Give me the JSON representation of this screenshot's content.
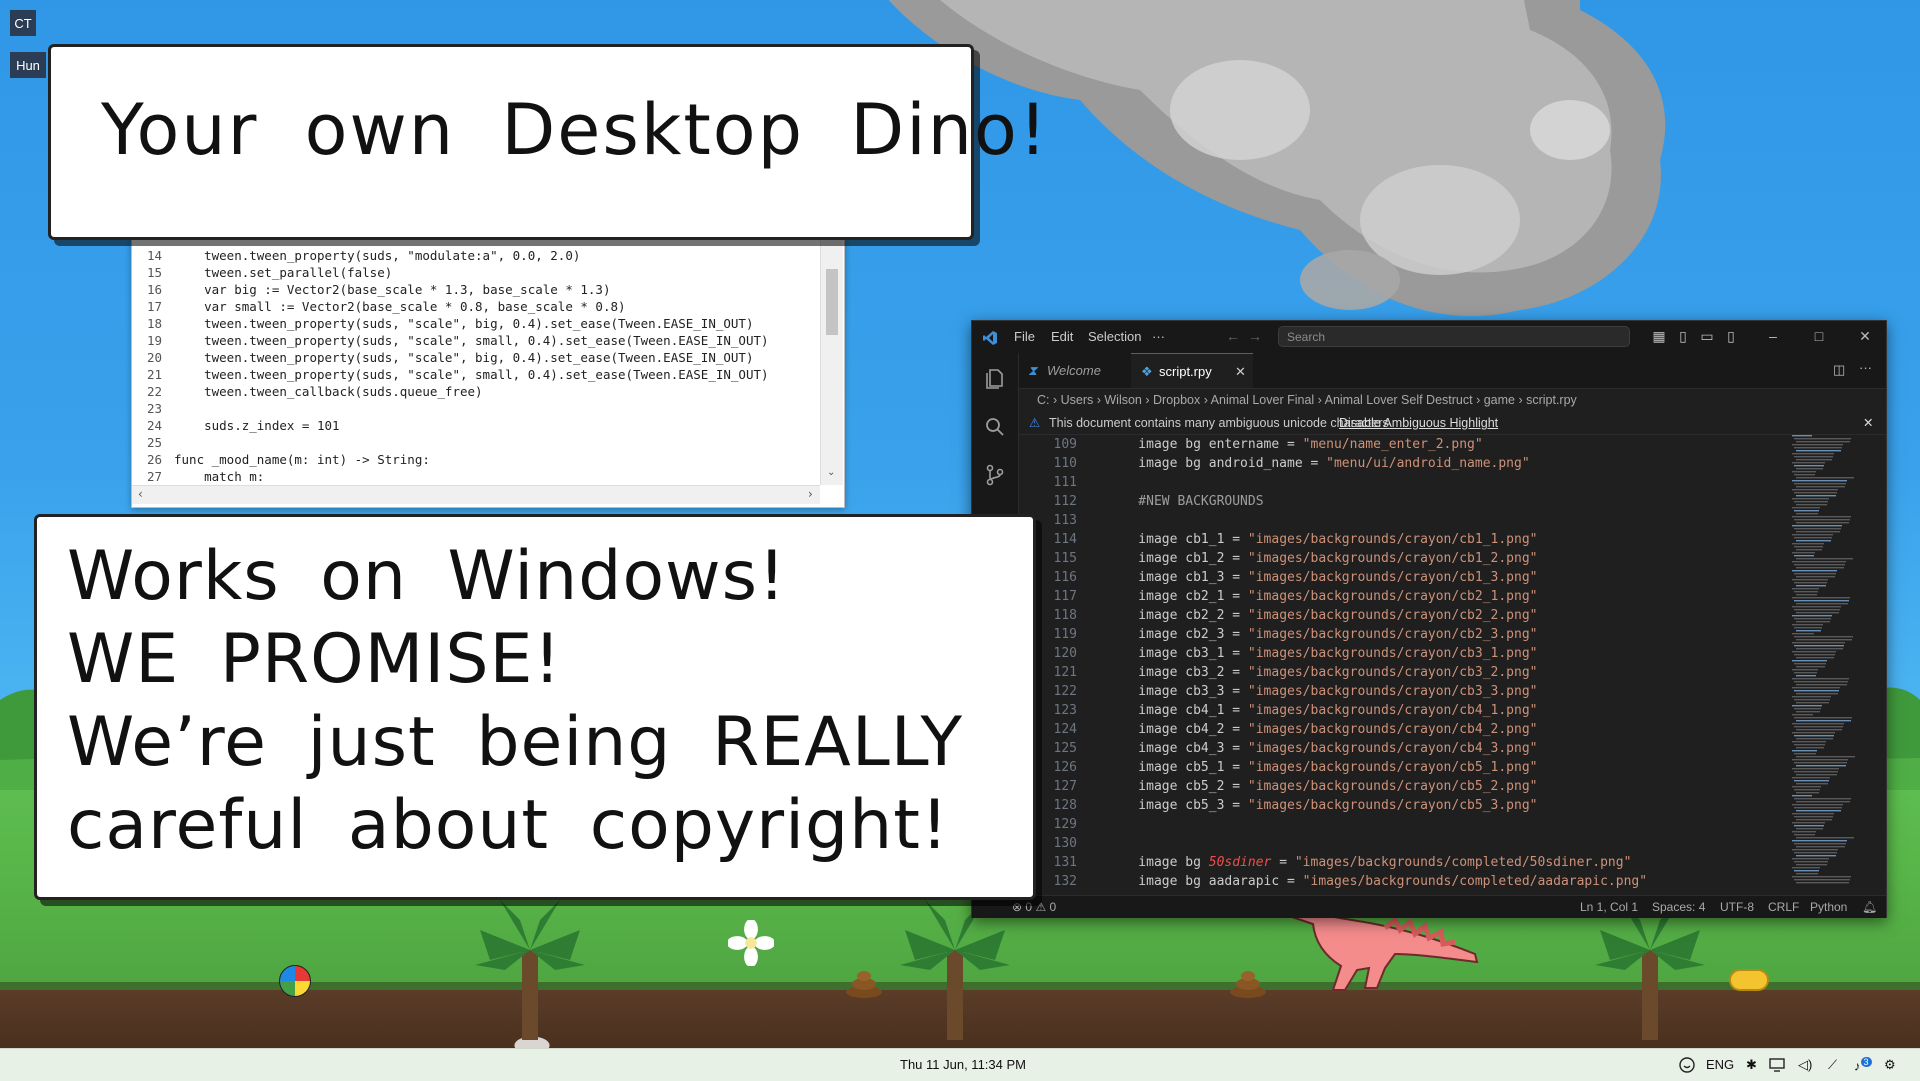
{
  "desktop": {
    "icons": [
      {
        "label": "CT"
      },
      {
        "label": "Hun"
      }
    ]
  },
  "captions": {
    "top": "Your own Desktop Dino!",
    "bottom": [
      "Works on Windows!",
      "WE PROMISE!",
      "We’re just being REALLY",
      "careful about copyright!"
    ]
  },
  "gd_editor": {
    "lines": [
      {
        "num": "14",
        "text": "    tween.tween_property(suds, \"modulate:a\", 0.0, 2.0)"
      },
      {
        "num": "15",
        "text": "    tween.set_parallel(false)"
      },
      {
        "num": "16",
        "text": "    var big := Vector2(base_scale * 1.3, base_scale * 1.3)"
      },
      {
        "num": "17",
        "text": "    var small := Vector2(base_scale * 0.8, base_scale * 0.8)"
      },
      {
        "num": "18",
        "text": "    tween.tween_property(suds, \"scale\", big, 0.4).set_ease(Tween.EASE_IN_OUT)"
      },
      {
        "num": "19",
        "text": "    tween.tween_property(suds, \"scale\", small, 0.4).set_ease(Tween.EASE_IN_OUT)"
      },
      {
        "num": "20",
        "text": "    tween.tween_property(suds, \"scale\", big, 0.4).set_ease(Tween.EASE_IN_OUT)"
      },
      {
        "num": "21",
        "text": "    tween.tween_property(suds, \"scale\", small, 0.4).set_ease(Tween.EASE_IN_OUT)"
      },
      {
        "num": "22",
        "text": "    tween.tween_callback(suds.queue_free)"
      },
      {
        "num": "23",
        "text": ""
      },
      {
        "num": "24",
        "text": "    suds.z_index = 101"
      },
      {
        "num": "25",
        "text": ""
      },
      {
        "num": "26",
        "text": "func _mood_name(m: int) -> String:"
      },
      {
        "num": "27",
        "text": "    match m:"
      }
    ]
  },
  "vscode": {
    "menu": [
      "File",
      "Edit",
      "Selection",
      "···"
    ],
    "search_placeholder": "Search",
    "tabs": [
      {
        "label": "Welcome"
      },
      {
        "label": "script.rpy"
      }
    ],
    "breadcrumb": [
      "C:",
      "Users",
      "Wilson",
      "Dropbox",
      "Animal Lover Final",
      "Animal Lover Self Destruct",
      "game",
      "script.rpy"
    ],
    "warning": {
      "message": "This document contains many ambiguous unicode characters",
      "action": "Disable Ambiguous Highlight"
    },
    "lines": [
      {
        "num": "109",
        "pre": "    image bg entername = ",
        "str": "\"menu/name_enter_2.png\""
      },
      {
        "num": "110",
        "pre": "    image bg android_name = ",
        "str": "\"menu/ui/android_name.png\""
      },
      {
        "num": "111",
        "pre": "",
        "str": ""
      },
      {
        "num": "112",
        "pre": "",
        "str": "",
        "cmt": "    #NEW BACKGROUNDS"
      },
      {
        "num": "113",
        "pre": "",
        "str": ""
      },
      {
        "num": "114",
        "pre": "    image cb1_1 = ",
        "str": "\"images/backgrounds/crayon/cb1_1.png\""
      },
      {
        "num": "115",
        "pre": "    image cb1_2 = ",
        "str": "\"images/backgrounds/crayon/cb1_2.png\""
      },
      {
        "num": "116",
        "pre": "    image cb1_3 = ",
        "str": "\"images/backgrounds/crayon/cb1_3.png\""
      },
      {
        "num": "117",
        "pre": "    image cb2_1 = ",
        "str": "\"images/backgrounds/crayon/cb2_1.png\""
      },
      {
        "num": "118",
        "pre": "    image cb2_2 = ",
        "str": "\"images/backgrounds/crayon/cb2_2.png\""
      },
      {
        "num": "119",
        "pre": "    image cb2_3 = ",
        "str": "\"images/backgrounds/crayon/cb2_3.png\""
      },
      {
        "num": "120",
        "pre": "    image cb3_1 = ",
        "str": "\"images/backgrounds/crayon/cb3_1.png\""
      },
      {
        "num": "121",
        "pre": "    image cb3_2 = ",
        "str": "\"images/backgrounds/crayon/cb3_2.png\""
      },
      {
        "num": "122",
        "pre": "    image cb3_3 = ",
        "str": "\"images/backgrounds/crayon/cb3_3.png\""
      },
      {
        "num": "123",
        "pre": "    image cb4_1 = ",
        "str": "\"images/backgrounds/crayon/cb4_1.png\""
      },
      {
        "num": "124",
        "pre": "    image cb4_2 = ",
        "str": "\"images/backgrounds/crayon/cb4_2.png\""
      },
      {
        "num": "125",
        "pre": "    image cb4_3 = ",
        "str": "\"images/backgrounds/crayon/cb4_3.png\""
      },
      {
        "num": "126",
        "pre": "    image cb5_1 = ",
        "str": "\"images/backgrounds/crayon/cb5_1.png\""
      },
      {
        "num": "127",
        "pre": "    image cb5_2 = ",
        "str": "\"images/backgrounds/crayon/cb5_2.png\""
      },
      {
        "num": "128",
        "pre": "    image cb5_3 = ",
        "str": "\"images/backgrounds/crayon/cb5_3.png\""
      },
      {
        "num": "129",
        "pre": "",
        "str": ""
      },
      {
        "num": "130",
        "pre": "",
        "str": ""
      },
      {
        "num": "131",
        "pre": "    image bg ",
        "hl": "50sdiner",
        "mid": " = ",
        "str": "\"images/backgrounds/completed/50sdiner.png\""
      },
      {
        "num": "132",
        "pre": "    image bg aadarapic = ",
        "str": "\"images/backgrounds/completed/aadarapic.png\""
      }
    ],
    "status": {
      "errors": "0",
      "warnings": "0",
      "position": "Ln 1, Col 1",
      "spaces": "Spaces: 4",
      "encoding": "UTF-8",
      "eol": "CRLF",
      "language": "Python"
    }
  },
  "taskbar": {
    "clock": "Thu 11 Jun, 11:34 PM",
    "language": "ENG",
    "notification_count": "3"
  }
}
